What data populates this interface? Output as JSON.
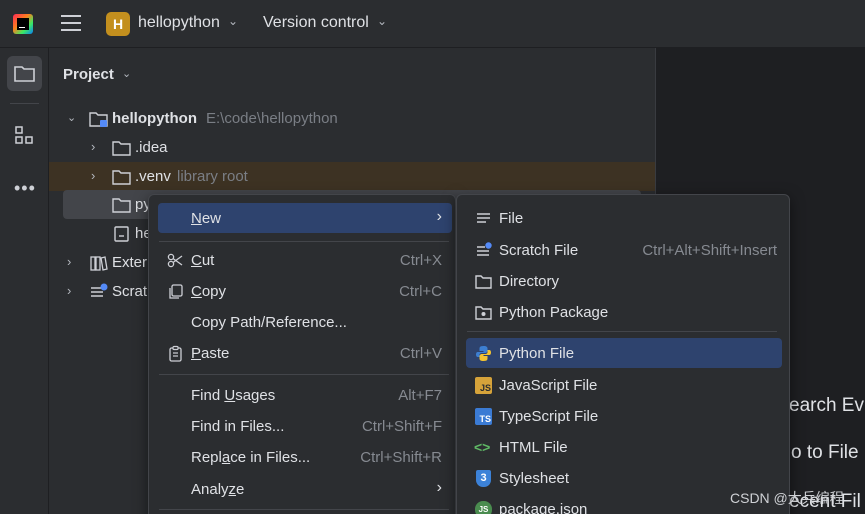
{
  "topbar": {
    "project_badge": "H",
    "project_name": "hellopython",
    "vcs_label": "Version control"
  },
  "panel": {
    "title": "Project"
  },
  "tree": {
    "root_name": "hellopython",
    "root_path": "E:\\code\\hellopython",
    "idea": ".idea",
    "venv": ".venv",
    "venv_hint": "library root",
    "selected_partial": "py",
    "file_partial": "he",
    "external_partial": "Exter",
    "scratch_partial": "Scrat"
  },
  "context_menu": {
    "new": {
      "label": "New",
      "u": "N",
      "rest": "ew"
    },
    "cut": {
      "label": "Cut",
      "u": "C",
      "rest": "ut",
      "shortcut": "Ctrl+X"
    },
    "copy": {
      "label": "Copy",
      "u": "C",
      "rest": "opy",
      "shortcut": "Ctrl+C"
    },
    "copy_path": "Copy Path/Reference...",
    "paste": {
      "label": "Paste",
      "u": "P",
      "rest": "aste",
      "shortcut": "Ctrl+V"
    },
    "find_usages": {
      "pre": "Find ",
      "u": "U",
      "rest": "sages",
      "shortcut": "Alt+F7"
    },
    "find_in_files": {
      "label": "Find in Files...",
      "shortcut": "Ctrl+Shift+F"
    },
    "replace_in_files": {
      "pre": "Repl",
      "u": "a",
      "rest": "ce in Files...",
      "shortcut": "Ctrl+Shift+R"
    },
    "analyze": {
      "pre": "Analy",
      "u": "z",
      "rest": "e"
    }
  },
  "new_submenu": {
    "file": "File",
    "scratch_file": "Scratch File",
    "scratch_shortcut": "Ctrl+Alt+Shift+Insert",
    "directory": "Directory",
    "python_package": "Python Package",
    "python_file": "Python File",
    "javascript_file": "JavaScript File",
    "typescript_file": "TypeScript File",
    "html_file": "HTML File",
    "stylesheet": "Stylesheet",
    "package_json": "package.json",
    "js_badge": "JS",
    "ts_badge": "TS",
    "html_glyph": "<>",
    "css_badge": "3",
    "npm_badge": "JS"
  },
  "hints": {
    "search": "earch Ev",
    "goto": "o to File",
    "recent": "ecent Fil"
  },
  "watermark": "CSDN @大兵编程",
  "colors": {
    "highlight": "#2e436e",
    "venv_row": "#3d3223",
    "selected_row": "#43454a",
    "project_badge": "#c38f1e"
  }
}
